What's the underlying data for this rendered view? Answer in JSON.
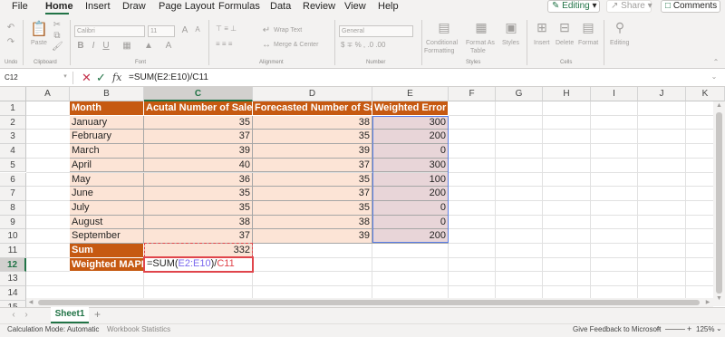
{
  "menu": {
    "items": [
      "File",
      "Home",
      "Insert",
      "Draw",
      "Page Layout",
      "Formulas",
      "Data",
      "Review",
      "View",
      "Help"
    ],
    "active": "Home",
    "editing_label": "Editing",
    "share_label": "Share",
    "comments_label": "Comments"
  },
  "ribbon": {
    "undo_label": "Undo",
    "paste_label": "Paste",
    "clipboard_label": "Clipboard",
    "font_name": "Calibri",
    "font_size": "11",
    "font_label": "Font",
    "wrap_text": "Wrap Text",
    "merge_center": "Merge & Center",
    "alignment_label": "Alignment",
    "number_format": "General",
    "number_label": "Number",
    "conditional_formatting": [
      "Conditional",
      "Formatting"
    ],
    "format_as_table": [
      "Format As",
      "Table"
    ],
    "styles": "Styles",
    "styles_label": "Styles",
    "insert": "Insert",
    "delete": "Delete",
    "format": "Format",
    "cells_label": "Cells",
    "editing": "Editing"
  },
  "formula_bar": {
    "name_box": "C12",
    "fx": "fx",
    "formula": "=SUM(E2:E10)/C11"
  },
  "columns": [
    "A",
    "B",
    "C",
    "D",
    "E",
    "F",
    "G",
    "H",
    "I",
    "J",
    "K"
  ],
  "rows": [
    "1",
    "2",
    "3",
    "4",
    "5",
    "6",
    "7",
    "8",
    "9",
    "10",
    "11",
    "12",
    "13",
    "14",
    "15"
  ],
  "table": {
    "headers": [
      "Month",
      "Acutal Number of Sales",
      "Forecasted Number of Sales",
      "Weighted Error"
    ],
    "data": [
      [
        "January",
        "35",
        "38",
        "300"
      ],
      [
        "February",
        "37",
        "35",
        "200"
      ],
      [
        "March",
        "39",
        "39",
        "0"
      ],
      [
        "April",
        "40",
        "37",
        "300"
      ],
      [
        "May",
        "36",
        "35",
        "100"
      ],
      [
        "June",
        "35",
        "37",
        "200"
      ],
      [
        "July",
        "35",
        "35",
        "0"
      ],
      [
        "August",
        "38",
        "38",
        "0"
      ],
      [
        "September",
        "37",
        "39",
        "200"
      ]
    ],
    "sum_label": "Sum",
    "sum_value": "332",
    "mape_label": "Weighted MAPE",
    "formula_parts": [
      "=SUM(",
      "E2:E10",
      ")/",
      "C11"
    ]
  },
  "colors": {
    "header_fill": "#c65911",
    "body_fill": "#fce4d6",
    "range_ref": "#7b68ee",
    "cell_ref": "#e0454b",
    "selection": "#217346"
  },
  "sheet": {
    "tab": "Sheet1",
    "add": "+"
  },
  "status": {
    "calc_mode": "Calculation Mode: Automatic",
    "workbook_stats": "Workbook Statistics",
    "feedback": "Give Feedback to Microsoft",
    "zoom": "125%"
  }
}
